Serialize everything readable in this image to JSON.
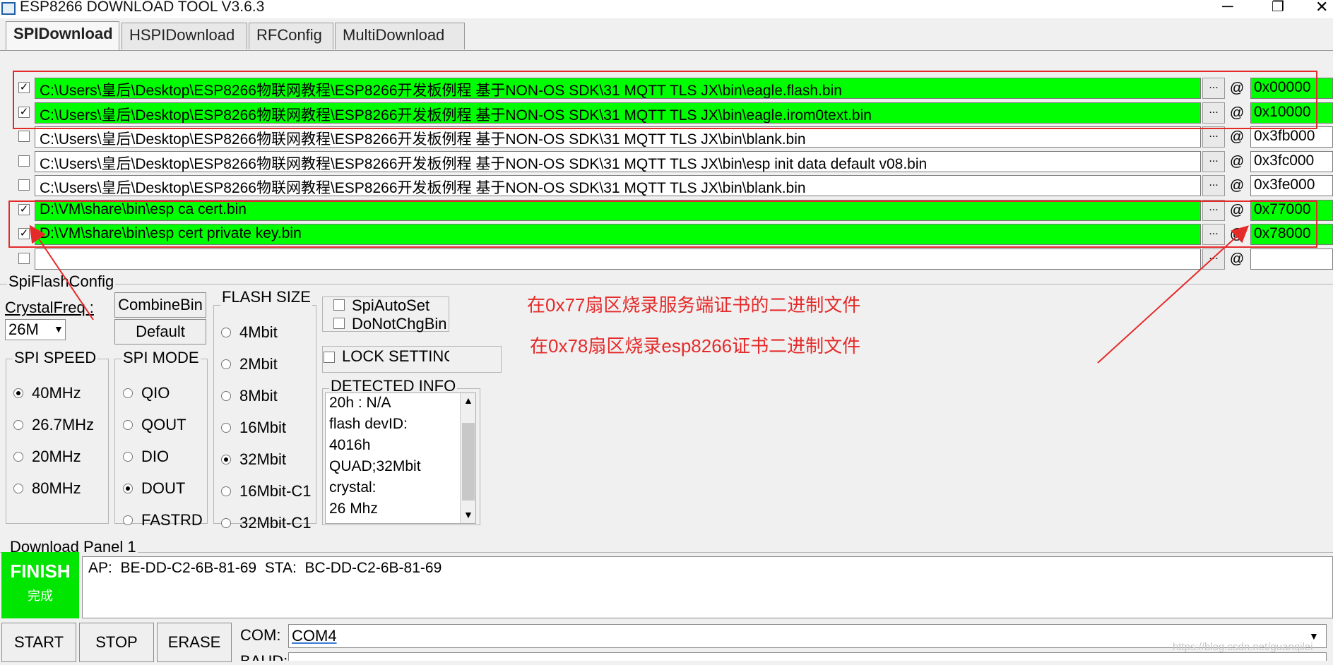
{
  "window": {
    "title": "ESP8266 DOWNLOAD TOOL V3.6.3",
    "minimize": "─",
    "maximize": "❐",
    "close": "✕"
  },
  "tabs": [
    {
      "label": "SPIDownload",
      "active": true
    },
    {
      "label": "HSPIDownload",
      "active": false
    },
    {
      "label": "RFConfig",
      "active": false
    },
    {
      "label": "MultiDownload",
      "active": false
    }
  ],
  "files": [
    {
      "checked": true,
      "path": "C:\\Users\\皇后\\Desktop\\ESP8266物联网教程\\ESP8266开发板例程 基于NON-OS SDK\\31 MQTT TLS JX\\bin\\eagle.flash.bin",
      "address": "0x00000",
      "highlighted": true
    },
    {
      "checked": true,
      "path": "C:\\Users\\皇后\\Desktop\\ESP8266物联网教程\\ESP8266开发板例程 基于NON-OS SDK\\31 MQTT TLS JX\\bin\\eagle.irom0text.bin",
      "address": "0x10000",
      "highlighted": true
    },
    {
      "checked": false,
      "path": "C:\\Users\\皇后\\Desktop\\ESP8266物联网教程\\ESP8266开发板例程 基于NON-OS SDK\\31 MQTT TLS JX\\bin\\blank.bin",
      "address": "0x3fb000",
      "highlighted": false
    },
    {
      "checked": false,
      "path": "C:\\Users\\皇后\\Desktop\\ESP8266物联网教程\\ESP8266开发板例程 基于NON-OS SDK\\31 MQTT TLS JX\\bin\\esp init data default v08.bin",
      "address": "0x3fc000",
      "highlighted": false
    },
    {
      "checked": false,
      "path": "C:\\Users\\皇后\\Desktop\\ESP8266物联网教程\\ESP8266开发板例程 基于NON-OS SDK\\31 MQTT TLS JX\\bin\\blank.bin",
      "address": "0x3fe000",
      "highlighted": false
    },
    {
      "checked": true,
      "path": "D:\\VM\\share\\bin\\esp ca cert.bin",
      "address": "0x77000",
      "highlighted": true
    },
    {
      "checked": true,
      "path": "D:\\VM\\share\\bin\\esp cert private key.bin",
      "address": "0x78000",
      "highlighted": true
    },
    {
      "checked": false,
      "path": "",
      "address": "",
      "highlighted": false
    }
  ],
  "browse_label": "...",
  "at_label": "@",
  "spiflash": {
    "title": "SpiFlashConfig",
    "crystal_label": "CrystalFreq :",
    "crystal_value": "26M",
    "combine_bin": "CombineBin",
    "default": "Default",
    "flash_size": {
      "title": "FLASH SIZE",
      "options": [
        "4Mbit",
        "2Mbit",
        "8Mbit",
        "16Mbit",
        "32Mbit",
        "16Mbit-C1",
        "32Mbit-C1"
      ],
      "selected": "32Mbit"
    },
    "spi_speed": {
      "title": "SPI SPEED",
      "options": [
        "40MHz",
        "26.7MHz",
        "20MHz",
        "80MHz"
      ],
      "selected": "40MHz"
    },
    "spi_mode": {
      "title": "SPI MODE",
      "options": [
        "QIO",
        "QOUT",
        "DIO",
        "DOUT",
        "FASTRD"
      ],
      "selected": "DOUT"
    },
    "spi_auto_set": "SpiAutoSet",
    "do_not_chg_bin": "DoNotChgBin",
    "lock_settings": "LOCK SETTINGS",
    "detected_info": {
      "title": "DETECTED INFO",
      "lines": [
        "20h : N/A",
        "flash devID:",
        "4016h",
        "QUAD;32Mbit",
        "crystal:",
        "26 Mhz"
      ]
    }
  },
  "annotations": [
    "在0x77扇区烧录服务端证书的二进制文件",
    "在0x78扇区烧录esp8266证书二进制文件"
  ],
  "download_panel": {
    "title": "Download Panel 1",
    "status": "FINISH",
    "status_cn": "完成",
    "log": "AP:  BE-DD-C2-6B-81-69  STA:  BC-DD-C2-6B-81-69",
    "start": "START",
    "stop": "STOP",
    "erase": "ERASE",
    "com_label": "COM:",
    "com_value": "COM4",
    "baud_label": "BAUD:"
  },
  "watermark": "https://blog.csdn.net/guanqilei",
  "colors": {
    "highlight": "#00ff00",
    "annotation": "#e52a2a",
    "finish_bg": "#00e600"
  }
}
